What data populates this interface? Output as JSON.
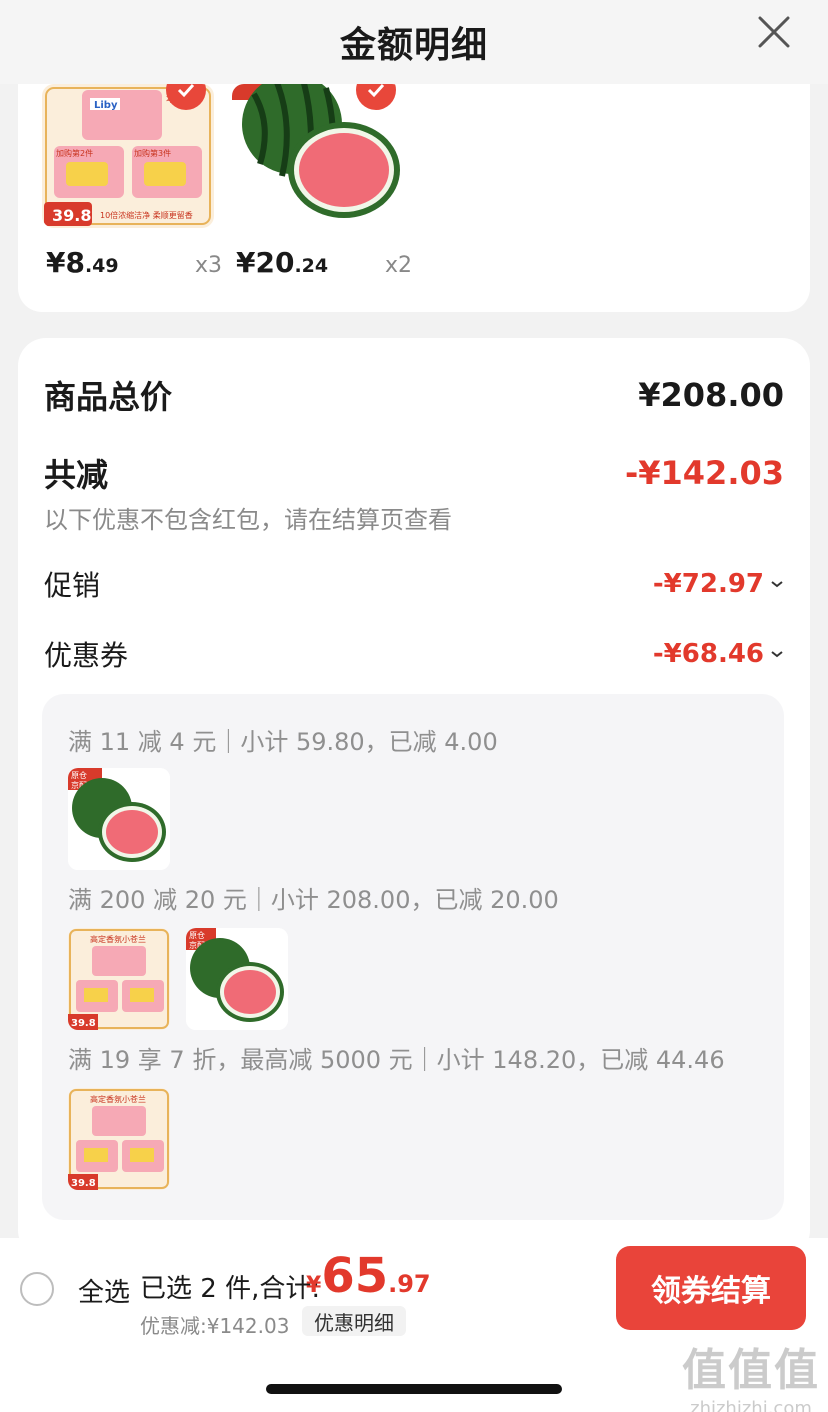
{
  "header": {
    "title": "金额明细",
    "close_icon": "close-icon"
  },
  "products": [
    {
      "name_hint": "Liby",
      "image_text": {
        "brand": "Liby",
        "price_badge": "39.8",
        "promo1": "加购第2件",
        "promo2": "加购第3件",
        "tagline": "10倍浓缩洁净 柔顺更留香",
        "corner": "本品"
      },
      "price_int": "¥8",
      "price_dec": ".49",
      "qty": "x3"
    },
    {
      "name_hint": "",
      "price_int": "¥20",
      "price_dec": ".24",
      "qty": "x2"
    }
  ],
  "summary": {
    "total_label": "商品总价",
    "total_value": "¥208.00",
    "reduce_label": "共减",
    "reduce_value": "-¥142.03",
    "note": "以下优惠不包含红包，请在结算页查看",
    "promo_label": "促销",
    "promo_value": "-¥72.97",
    "coupon_label": "优惠券",
    "coupon_value": "-¥68.46"
  },
  "coupon_details": [
    {
      "line": "满 11 减 4 元｜小计 59.80，已减 4.00"
    },
    {
      "line": "满 200 减 20 元｜小计 208.00，已减 20.00"
    },
    {
      "line": "满 19 享 7 折，最高减 5000 元｜小计 148.20，已减 44.46"
    }
  ],
  "mini_labels": {
    "fresh_badge": "原仓\n京配",
    "liby_title": "高定香氛小苍兰",
    "liby_price": "39.8"
  },
  "bottom": {
    "select_all": "全选",
    "selected": "已选 2 件,合计:",
    "currency": "¥",
    "total_int": "65",
    "total_dec": ".97",
    "discount": "优惠减:¥142.03",
    "detail_button": "优惠明细",
    "checkout_button": "领券结算"
  },
  "watermark": {
    "logo": "值值值",
    "url": "zhizhizhi.com"
  },
  "colors": {
    "accent": "#e2392c",
    "button": "#e9443a",
    "background": "#f2f2f2"
  }
}
